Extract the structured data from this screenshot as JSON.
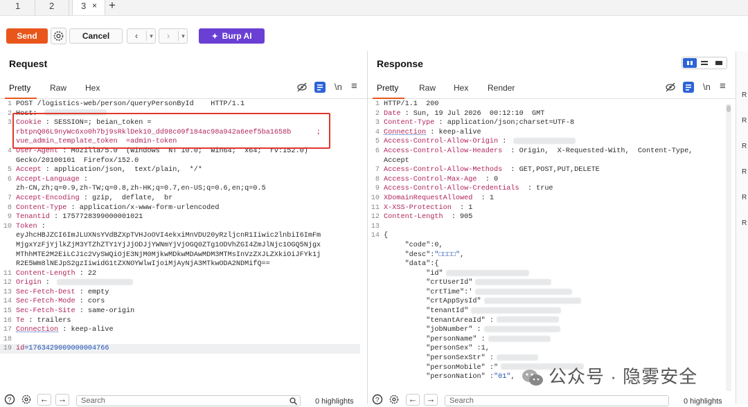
{
  "tabs": [
    {
      "label": "1"
    },
    {
      "label": "2"
    },
    {
      "label": "3",
      "close": "×"
    }
  ],
  "tab_add": "+",
  "toolbar": {
    "send": "Send",
    "cancel": "Cancel",
    "prev": "‹",
    "next": "›",
    "dropdown": "▾",
    "burp_ai": "Burp AI",
    "burp_ai_icon": "✦"
  },
  "request": {
    "title": "Request",
    "tabs": [
      "Pretty",
      "Raw",
      "Hex"
    ],
    "newline": "\\n",
    "menu": "≡",
    "lines": [
      {
        "n": "1",
        "t": "POST /logistics-web/person/queryPersonById    HTTP/1.1"
      },
      {
        "n": "2",
        "t": "Host: "
      },
      {
        "n": "3",
        "k": "Cookie",
        "t": " : SESSION=; beian_token ="
      },
      {
        "n": "",
        "s": "rbtpnQ06L9nyWc6xo0h7bj9sRklDek10_dd98c09f184ac98a942a6eef5ba1658b      ;"
      },
      {
        "n": "",
        "s": "vue_admin_template_token  =admin-token"
      },
      {
        "n": "4",
        "k": "User-Agent",
        "t": " : Mozilla/5.0  (Windows  NT 10.0;  Win64;  x64;  rv:152.0)"
      },
      {
        "n": "",
        "t": "Gecko/20100101  Firefox/152.0"
      },
      {
        "n": "5",
        "k": "Accept",
        "t": " : application/json,  text/plain,  */*"
      },
      {
        "n": "6",
        "k": "Accept-Language",
        "t": " :"
      },
      {
        "n": "",
        "t": "zh-CN,zh;q=0.9,zh-TW;q=0.8,zh-HK;q=0.7,en-US;q=0.6,en;q=0.5"
      },
      {
        "n": "7",
        "k": "Accept-Encoding",
        "t": " : gzip,  deflate,  br"
      },
      {
        "n": "8",
        "k": "Content-Type",
        "t": " : application/x-www-form-urlencoded"
      },
      {
        "n": "9",
        "k": "Tenantid",
        "t": " : 1757728399000001021"
      },
      {
        "n": "10",
        "k": "Token",
        "t": " :"
      },
      {
        "n": "",
        "t": "eyJhcHBJZCI6ImJLUXNsYVdBZXpTVHJoOVI4ekxiMnVDU20yRzljcnR1Iiwic2lnbiI6ImFm"
      },
      {
        "n": "",
        "t": "MjgxYzFjYjlkZjM3YTZhZTY1YjJjODJjYWNmYjVjOGQ0ZTg1ODVhZGI4ZmJlNjc1OGQ5Njgx"
      },
      {
        "n": "",
        "t": "MThhMTE2M2EiLCJ1c2VySWQiOjE3NjM0MjkwMDkwMDAwMDM3MTMsInVzZXJLZXkiOiJFYk1j"
      },
      {
        "n": "",
        "t": "R2E5Wm8lNEJpS2gzIiwidG1tZXNOYWlwIjoiMjAyNjA3MTkwODA2NDMifQ=="
      },
      {
        "n": "11",
        "k": "Content-Length",
        "t": " : 22"
      },
      {
        "n": "12",
        "k": "Origin",
        "t": " : "
      },
      {
        "n": "13",
        "k": "Sec-Fetch-Dest",
        "t": " : empty"
      },
      {
        "n": "14",
        "k": "Sec-Fetch-Mode",
        "t": " : cors"
      },
      {
        "n": "15",
        "k": "Sec-Fetch-Site",
        "t": " : same-origin"
      },
      {
        "n": "16",
        "k": "Te",
        "t": " : trailers"
      },
      {
        "n": "17",
        "k": "Connection",
        "t": " : keep-alive"
      },
      {
        "n": "18",
        "t": ""
      },
      {
        "n": "19",
        "p": "id",
        "t": "=1763429009000004766"
      }
    ],
    "search_placeholder": "Search",
    "highlights": "0 highlights"
  },
  "response": {
    "title": "Response",
    "tabs": [
      "Pretty",
      "Raw",
      "Hex",
      "Render"
    ],
    "newline": "\\n",
    "menu": "≡",
    "lines": [
      {
        "n": "1",
        "t": "HTTP/1.1  200"
      },
      {
        "n": "2",
        "k": "Date",
        "t": " : Sun, 19 Jul 2026  00:12:10  GMT"
      },
      {
        "n": "3",
        "k": "Content-Type",
        "t": " : application/json;charset=UTF-8"
      },
      {
        "n": "4",
        "k": "Connection",
        "t": " : keep-alive"
      },
      {
        "n": "5",
        "k": "Access-Control-Allow-Origin",
        "t": " : "
      },
      {
        "n": "6",
        "k": "Access-Control-Allow-Headers",
        "t": "  : Origin,  X-Requested-With,  Content-Type,"
      },
      {
        "n": "",
        "t": "Accept"
      },
      {
        "n": "7",
        "k": "Access-Control-Allow-Methods",
        "t": "  : GET,POST,PUT,DELETE"
      },
      {
        "n": "8",
        "k": "Access-Control-Max-Age",
        "t": "  : 0"
      },
      {
        "n": "9",
        "k": "Access-Control-Allow-Credentials",
        "t": "  : true"
      },
      {
        "n": "10",
        "k": "XDomainRequestAllowed",
        "t": "  : 1"
      },
      {
        "n": "11",
        "k": "X-XSS-Protection",
        "t": "  : 1"
      },
      {
        "n": "12",
        "k": "Content-Length",
        "t": "  : 905"
      },
      {
        "n": "13",
        "t": ""
      },
      {
        "n": "14",
        "t": "{"
      },
      {
        "n": "",
        "j": "     \"code\"",
        "t": ":0,"
      },
      {
        "n": "",
        "j": "     \"desc\"",
        "t": ":",
        "v": "\"□□□□\"",
        "e": ","
      },
      {
        "n": "",
        "j": "     \"data\"",
        "t": ":{"
      },
      {
        "n": "",
        "j": "          \"id\"",
        "t": ""
      },
      {
        "n": "",
        "j": "          \"crtUserId\"",
        "t": ""
      },
      {
        "n": "",
        "j": "          \"crtTime\"",
        "t": ":'"
      },
      {
        "n": "",
        "j": "          \"crtAppSysId\"",
        "t": ""
      },
      {
        "n": "",
        "j": "          \"tenantId\"",
        "t": ""
      },
      {
        "n": "",
        "j": "          \"tenantAreaId\"",
        "t": " :"
      },
      {
        "n": "",
        "j": "          \"jobNumber\"",
        "t": " :"
      },
      {
        "n": "",
        "j": "          \"personName\"",
        "t": " :"
      },
      {
        "n": "",
        "j": "          \"personSex\"",
        "t": " :1,"
      },
      {
        "n": "",
        "j": "          \"personSexStr\"",
        "t": " :"
      },
      {
        "n": "",
        "j": "          \"personMobile\"",
        "t": " :\""
      },
      {
        "n": "",
        "j": "          \"personNation\"",
        "t": " :",
        "v": "\"01\"",
        "e": ","
      }
    ],
    "search_placeholder": "Search",
    "highlights": "0 highlights"
  },
  "sidebar": [
    "R",
    "R",
    "R",
    "R",
    "R",
    "R"
  ],
  "watermark": "公众号 · 隐雾安全",
  "colors": {
    "accent": "#e8561b",
    "burp": "#6a3fd3",
    "header_key": "#b0245c",
    "value_blue": "#1d4fb5",
    "red_box": "#e0362c"
  }
}
